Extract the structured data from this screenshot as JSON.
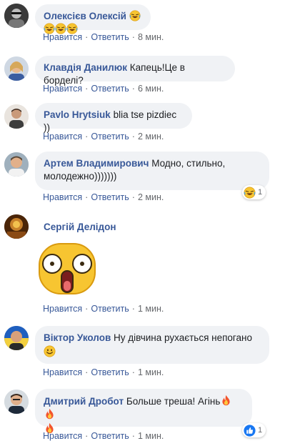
{
  "actions": {
    "like": "Нравится",
    "reply": "Ответить"
  },
  "comments": [
    {
      "author": "Олексієв Олексій",
      "text": "",
      "emoji": [
        "laugh",
        "laugh",
        "laugh",
        "laugh"
      ],
      "time": "8 мин."
    },
    {
      "author": "Клавдія Данилюк",
      "text": "Капець!Це в борделі?",
      "time": "6 мин."
    },
    {
      "author": "Pavlo Hrytsiuk",
      "text": "blia tse pizdiec ))",
      "time": "2 мин."
    },
    {
      "author": "Артем Владимирович",
      "text_line1": "Модно, стильно,",
      "text_line2": "молодежно)))))))",
      "time": "2 мин.",
      "reaction": {
        "type": "haha",
        "count": "1"
      }
    },
    {
      "author": "Сергій Делідон",
      "text": "",
      "sticker": "shocked-face",
      "time": "1 мин."
    },
    {
      "author": "Віктор Уколов",
      "text": "Ну дівчина рухається непогано",
      "emoji": [
        "smile"
      ],
      "time": "1 мин."
    },
    {
      "author": "Дмитрий Дробот",
      "text": "Больше треша! Агінь",
      "emoji": [
        "fire",
        "fire",
        "fire"
      ],
      "time": "1 мин.",
      "reaction": {
        "type": "like",
        "count": "1"
      }
    }
  ],
  "colors": {
    "author": "#385898",
    "bubble": "#f0f2f5",
    "meta": "#65676b"
  }
}
